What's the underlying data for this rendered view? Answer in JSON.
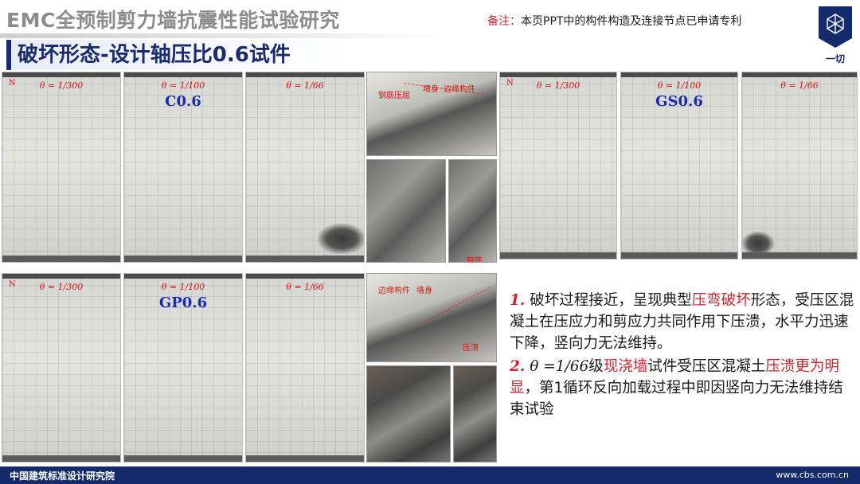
{
  "header": {
    "title": "EMC全预制剪力墙抗震性能试验研究",
    "note_label": "备注：",
    "note_text": "本页PPT中的构件构造及连接节点已申请专利",
    "logo_text": "一切"
  },
  "subtitle": "破坏形态-设计轴压比0.6试件",
  "row1_left": {
    "photos": [
      {
        "theta": "θ = 1/300",
        "n": "N"
      },
      {
        "theta": "θ = 1/100",
        "spec": "C0.6"
      },
      {
        "theta": "θ = 1/66"
      }
    ]
  },
  "row1_detail": {
    "labels": [
      "钢筋压屈",
      "墙身",
      "边缘构件",
      "钢筋"
    ]
  },
  "row1_right": {
    "photos": [
      {
        "theta": "θ = 1/300",
        "n": "N"
      },
      {
        "theta": "θ = 1/100",
        "spec": "GS0.6"
      },
      {
        "theta": "θ = 1/66"
      }
    ]
  },
  "row2_left": {
    "photos": [
      {
        "theta": "θ = 1/300",
        "n": "N"
      },
      {
        "theta": "θ = 1/100",
        "spec": "GP0.6"
      },
      {
        "theta": "θ = 1/66"
      }
    ]
  },
  "row2_detail": {
    "labels": [
      "边缘构件",
      "墙身",
      "压溃"
    ]
  },
  "body": {
    "p1_num": "1.",
    "p1_a": "破坏过程接近，呈现典型",
    "p1_hl": "压弯破坏",
    "p1_b": "形态，受压区混凝土在压应力和剪应力共同作用下压溃，水平力迅速下降，竖向力无法维持。",
    "p2_num": "2.",
    "p2_theta": "θ =1/66",
    "p2_a": "级",
    "p2_hl1": "现浇墙",
    "p2_b": "试件受压区混凝土",
    "p2_hl2": "压溃更为明显",
    "p2_c": "，第1循环反向加载过程中即因竖向力无法维持结束试验"
  },
  "footer": {
    "org": "中国建筑标准设计研究院",
    "url": "www.cbs.com.cn"
  },
  "colors": {
    "navy": "#132a6b",
    "subtitle": "#1a2a6e",
    "accent_red": "#c8282d",
    "spec_blue": "#1b2bb0"
  }
}
